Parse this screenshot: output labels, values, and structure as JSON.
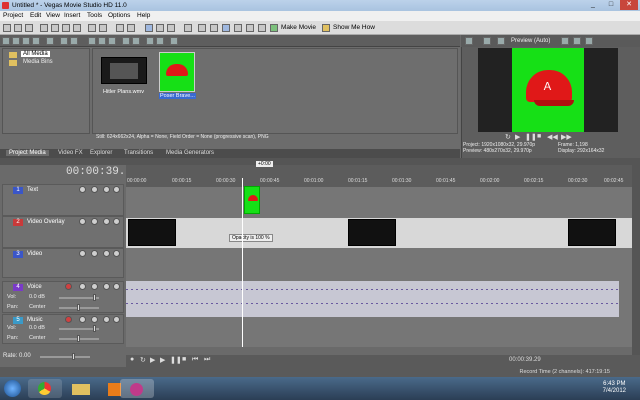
{
  "window": {
    "title": "Untitled * - Vegas Movie Studio HD 11.0",
    "controls": [
      "_",
      "□",
      "✕"
    ]
  },
  "menu": [
    "Project",
    "Edit",
    "View",
    "Insert",
    "Tools",
    "Options",
    "Help"
  ],
  "toolbar": {
    "make_movie": "Make Movie",
    "show_me_how": "Show Me How"
  },
  "media_tree": {
    "items": [
      "All Media",
      "Media Bins"
    ]
  },
  "media_files": [
    {
      "name": "Hitler Plans.wmv"
    },
    {
      "name": "Poser Brave..."
    }
  ],
  "media_info": "Still: 624x662x24, Alpha = None, Field Order = None (progressive scan), PNG",
  "tabs": [
    "Project Media",
    "Video FX",
    "Explorer",
    "Transitions",
    "Media Generators"
  ],
  "preview": {
    "mode": "Preview (Auto)",
    "project": "Project:   1920x1080x32, 29.970p",
    "preview": "Preview:   480x270x32, 29.970p",
    "frame": "Frame:     1,198",
    "display": "Display:   292x164x32"
  },
  "timeline": {
    "timecode": "00:00:39.29",
    "marker": "+0:00",
    "ruler": [
      "00:00:00",
      "00:00:15",
      "00:00:30",
      "00:00:45",
      "00:01:00",
      "00:01:15",
      "00:01:30",
      "00:01:45",
      "00:02:00",
      "00:02:15",
      "00:02:30",
      "00:02:45"
    ],
    "tooltip": "Opacity is 100 %",
    "tracks": [
      {
        "num": "1",
        "name": "Text",
        "color": "#3a56c8"
      },
      {
        "num": "2",
        "name": "Video Overlay",
        "color": "#c83a3a"
      },
      {
        "num": "3",
        "name": "Video",
        "color": "#3a56c8"
      },
      {
        "num": "4",
        "name": "Voice",
        "color": "#7a3ac8",
        "vol_label": "Vol:",
        "vol": "0.0 dB",
        "pan_label": "Pan:",
        "pan": "Center"
      },
      {
        "num": "5",
        "name": "Music",
        "color": "#3a9ac8",
        "vol_label": "Vol:",
        "vol": "0.0 dB",
        "pan_label": "Pan:",
        "pan": "Center"
      }
    ],
    "rate": "Rate: 0.00",
    "transport_time": "00:00:39.29",
    "record_time": "Record Time (2 channels): 417:19:15"
  },
  "taskbar": {
    "time": "6:43 PM",
    "date": "7/4/2012"
  },
  "colors": {
    "green_screen": "#16e016",
    "cap_red": "#e01818"
  }
}
